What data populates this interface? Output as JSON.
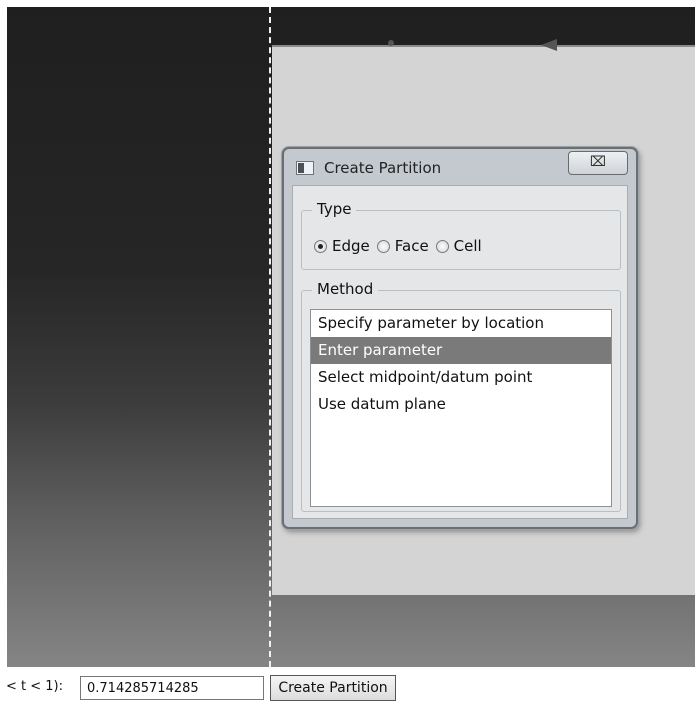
{
  "dialog": {
    "title": "Create Partition",
    "close_label": "⌧",
    "type_group": {
      "label": "Type",
      "options": [
        {
          "label": "Edge",
          "checked": true
        },
        {
          "label": "Face",
          "checked": false
        },
        {
          "label": "Cell",
          "checked": false
        }
      ]
    },
    "method_group": {
      "label": "Method",
      "items": [
        "Specify parameter by location",
        "Enter parameter",
        "Select midpoint/datum point",
        "Use datum plane"
      ],
      "selected_index": 1
    }
  },
  "prompt": {
    "label": "< t < 1):",
    "value": "0.714285714285",
    "button_label": "Create Partition"
  }
}
